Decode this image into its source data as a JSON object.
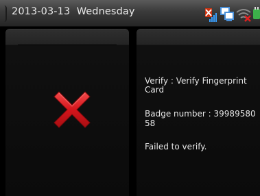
{
  "status_bar": {
    "date": "2013-03-13",
    "weekday": "Wednesday"
  },
  "status_icons": [
    "signal-error-icon",
    "network-icon",
    "wifi-off-icon",
    "power-icon"
  ],
  "result": {
    "icon": "red-x-failure-icon",
    "color": "#d4151c"
  },
  "message": {
    "verify_line1": "Verify : Verify Fingerprint",
    "verify_line2": "Card",
    "badge_line1": "Badge number : 39989580",
    "badge_line2": "58",
    "status": "Failed to verify."
  }
}
